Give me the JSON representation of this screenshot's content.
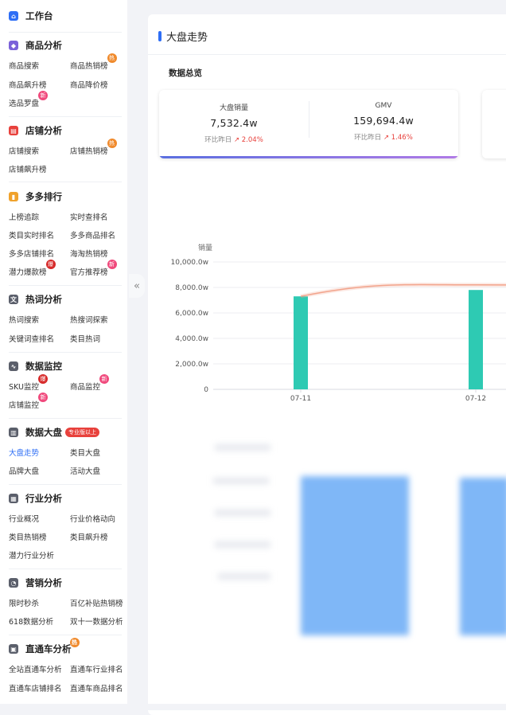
{
  "sidebar": {
    "workbench": "工作台",
    "sections": [
      {
        "title": "商品分析",
        "icon": "bag-icon",
        "items": [
          {
            "label": "商品搜索"
          },
          {
            "label": "商品热销榜",
            "badge": "热"
          },
          {
            "label": "商品飙升榜"
          },
          {
            "label": "商品降价榜"
          },
          {
            "label": "选品罗盘",
            "badge": "新"
          }
        ]
      },
      {
        "title": "店铺分析",
        "icon": "store-icon",
        "items": [
          {
            "label": "店铺搜索"
          },
          {
            "label": "店铺热销榜",
            "badge": "热"
          },
          {
            "label": "店铺飙升榜"
          }
        ]
      },
      {
        "title": "多多排行",
        "icon": "ranking-icon",
        "items": [
          {
            "label": "上榜追踪"
          },
          {
            "label": "实时查排名"
          },
          {
            "label": "类目实时排名"
          },
          {
            "label": "多多商品排名"
          },
          {
            "label": "多多店铺排名"
          },
          {
            "label": "海淘热销榜"
          },
          {
            "label": "潜力爆款榜",
            "badge": "爆"
          },
          {
            "label": "官方推荐榜",
            "badge": "新"
          }
        ]
      },
      {
        "title": "热词分析",
        "icon": "keyword-icon",
        "items": [
          {
            "label": "热词搜索"
          },
          {
            "label": "热搜词探索"
          },
          {
            "label": "关键词查排名"
          },
          {
            "label": "类目热词"
          }
        ]
      },
      {
        "title": "数据监控",
        "icon": "monitor-icon",
        "items": [
          {
            "label": "SKU监控",
            "badge": "爆"
          },
          {
            "label": "商品监控",
            "badge": "新"
          },
          {
            "label": "店铺监控",
            "badge": "新"
          }
        ]
      },
      {
        "title": "数据大盘",
        "icon": "dashboard-icon",
        "pill": "专业版以上",
        "items": [
          {
            "label": "大盘走势",
            "active": true
          },
          {
            "label": "类目大盘"
          },
          {
            "label": "品牌大盘"
          },
          {
            "label": "活动大盘"
          }
        ]
      },
      {
        "title": "行业分析",
        "icon": "industry-icon",
        "items": [
          {
            "label": "行业概况"
          },
          {
            "label": "行业价格动向"
          },
          {
            "label": "类目热销榜"
          },
          {
            "label": "类目飙升榜"
          },
          {
            "label": "潜力行业分析"
          }
        ]
      },
      {
        "title": "营销分析",
        "icon": "marketing-icon",
        "items": [
          {
            "label": "限时秒杀"
          },
          {
            "label": "百亿补贴热销榜"
          },
          {
            "label": "618数据分析"
          },
          {
            "label": "双十一数据分析"
          }
        ]
      },
      {
        "title": "直通车分析",
        "icon": "train-icon",
        "badge": "热",
        "items": [
          {
            "label": "全站直通车分析"
          },
          {
            "label": "直通车行业排名"
          },
          {
            "label": "直通车店铺排名"
          },
          {
            "label": "直通车商品排名"
          }
        ]
      }
    ]
  },
  "collapse_glyph": "«",
  "main": {
    "title": "大盘走势",
    "overview_title": "数据总览",
    "metrics": [
      {
        "label": "大盘销量",
        "value": "7,532.4w",
        "compare_label": "环比昨日",
        "change": "2.04%"
      },
      {
        "label": "GMV",
        "value": "159,694.4w",
        "compare_label": "环比昨日",
        "change": "1.46%"
      }
    ]
  },
  "chart_data": {
    "type": "bar",
    "ylabel": "销量",
    "ylim": [
      0,
      10000
    ],
    "yticks": [
      "0",
      "2,000.0w",
      "4,000.0w",
      "6,000.0w",
      "8,000.0w",
      "10,000.0w"
    ],
    "categories": [
      "07-11",
      "07-12"
    ],
    "series": [
      {
        "type": "bar",
        "values": [
          7300,
          7800
        ],
        "color": "#2ecab3"
      },
      {
        "type": "line",
        "values": [
          7300,
          8200
        ],
        "color": "#f2a48c"
      }
    ]
  },
  "colors": {
    "accent": "#2e6ef5",
    "up": "#e8413c",
    "bar": "#2ecab3",
    "line": "#f2a48c"
  }
}
